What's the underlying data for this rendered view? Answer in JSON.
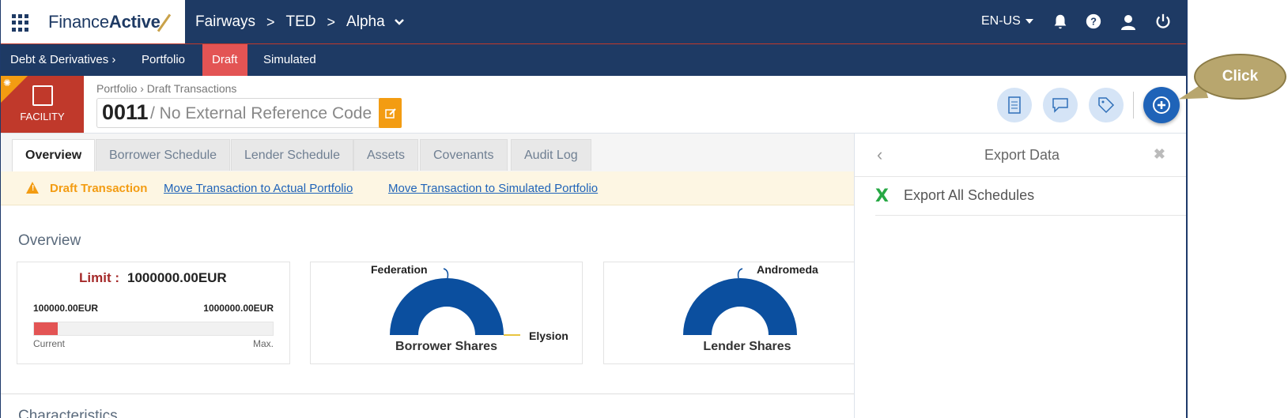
{
  "logo": {
    "prefix": "Finance",
    "suffix": "Active"
  },
  "breadcrumbs": [
    "Fairways",
    "TED",
    "Alpha"
  ],
  "breadcrumb_sep": ">",
  "lang": "EN-US",
  "subnav": {
    "section": "Debt & Derivatives",
    "section_chevron": "›",
    "items": [
      "Portfolio",
      "Draft",
      "Simulated"
    ],
    "active": "Draft"
  },
  "facility": {
    "label": "FACILITY"
  },
  "header": {
    "crumb": "Portfolio › Draft Transactions",
    "code": "0011",
    "ref": "/ No External Reference Code"
  },
  "tabs": [
    "Overview",
    "Borrower Schedule",
    "Lender Schedule",
    "Assets",
    "Covenants",
    "Audit Log"
  ],
  "active_tab": "Overview",
  "banner": {
    "title": "Draft Transaction",
    "link1": "Move Transaction to Actual Portfolio",
    "link2": "Move Transaction to Simulated Portfolio"
  },
  "overview": {
    "title": "Overview",
    "limit": {
      "label": "Limit :",
      "value": "1000000.00EUR",
      "current": "100000.00EUR",
      "max": "1000000.00EUR",
      "current_label": "Current",
      "max_label": "Max.",
      "fill_fraction": 0.1
    },
    "borrower": {
      "caption": "Borrower Shares",
      "label_a": "Federation",
      "label_b": "Elysion"
    },
    "lender": {
      "caption": "Lender Shares",
      "label_a": "Andromeda"
    }
  },
  "characteristics": "Characteristics",
  "panel": {
    "title": "Export Data",
    "back": "‹",
    "close": "✖",
    "item": "Export All Schedules",
    "item_icon": "X"
  },
  "callout": "Click",
  "colors": {
    "navy": "#1e3a64",
    "draft": "#e35454",
    "accent": "#1f63b8",
    "warning": "#f39c12",
    "donut": "#0b4f9f"
  }
}
